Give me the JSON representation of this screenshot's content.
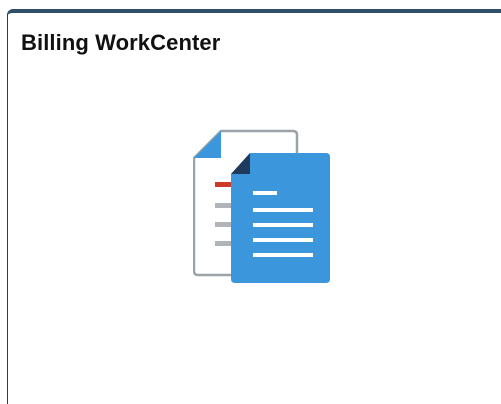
{
  "tile": {
    "title": "Billing WorkCenter",
    "icon": "documents-icon"
  },
  "colors": {
    "title_text": "#111111",
    "tile_top_border": "#2e4e6a",
    "doc_front": "#3b96dc",
    "doc_front_fold": "#1f3a5c",
    "doc_back_outline": "#9aa3a8",
    "doc_back_fold": "#3b96dc",
    "doc_back_red_line": "#cc3a2a",
    "doc_back_grey_line": "#b0b4b8"
  }
}
